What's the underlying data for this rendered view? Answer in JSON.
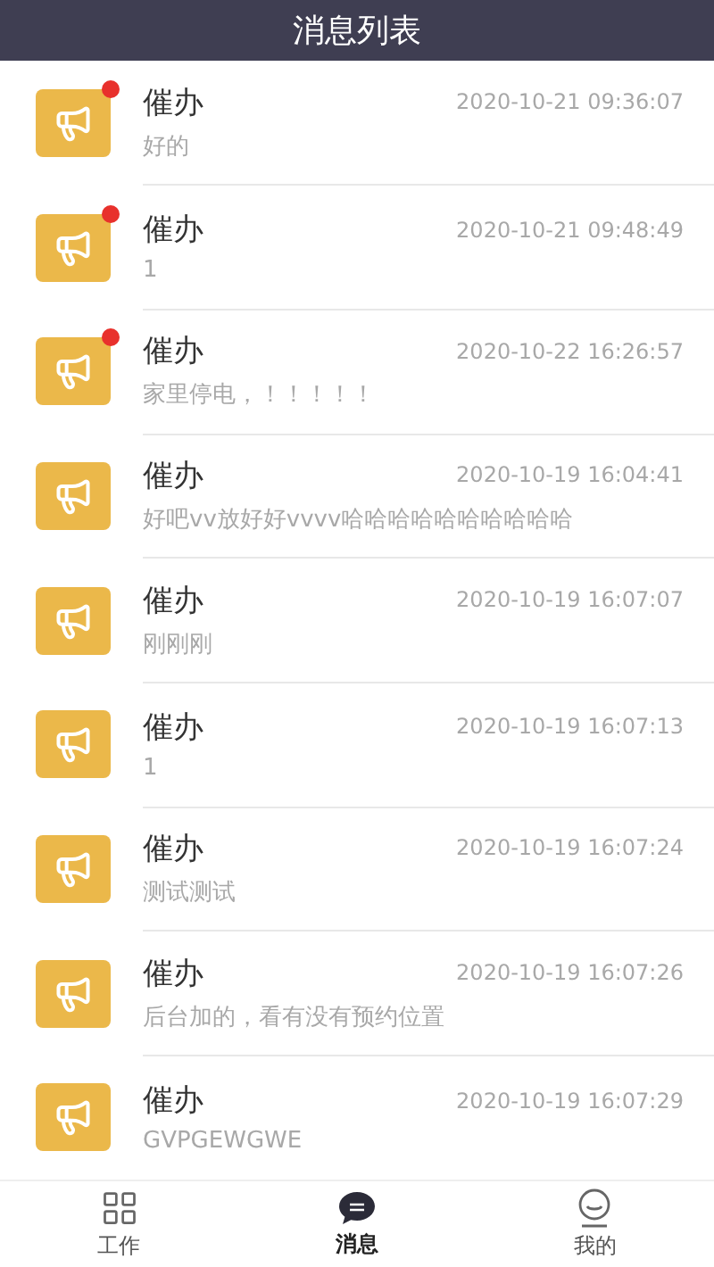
{
  "header": {
    "title": "消息列表"
  },
  "messages": [
    {
      "title": "催办",
      "time": "2020-10-21 09:36:07",
      "text": "好的",
      "unread": true
    },
    {
      "title": "催办",
      "time": "2020-10-21 09:48:49",
      "text": "1",
      "unread": true
    },
    {
      "title": "催办",
      "time": "2020-10-22 16:26:57",
      "text": "家里停电，！！！！！",
      "unread": true
    },
    {
      "title": "催办",
      "time": "2020-10-19 16:04:41",
      "text": "好吧vv放好好vvvv哈哈哈哈哈哈哈哈哈哈",
      "unread": false
    },
    {
      "title": "催办",
      "time": "2020-10-19 16:07:07",
      "text": "刚刚刚",
      "unread": false
    },
    {
      "title": "催办",
      "time": "2020-10-19 16:07:13",
      "text": "1",
      "unread": false
    },
    {
      "title": "催办",
      "time": "2020-10-19 16:07:24",
      "text": "测试测试",
      "unread": false
    },
    {
      "title": "催办",
      "time": "2020-10-19 16:07:26",
      "text": "后台加的，看有没有预约位置",
      "unread": false
    },
    {
      "title": "催办",
      "time": "2020-10-19 16:07:29",
      "text": "GVPGEWGWE",
      "unread": false
    }
  ],
  "tabbar": [
    {
      "kind": "work",
      "label": "工作",
      "selected": false
    },
    {
      "kind": "message",
      "label": "消息",
      "selected": true
    },
    {
      "kind": "mine",
      "label": "我的",
      "selected": false
    }
  ]
}
